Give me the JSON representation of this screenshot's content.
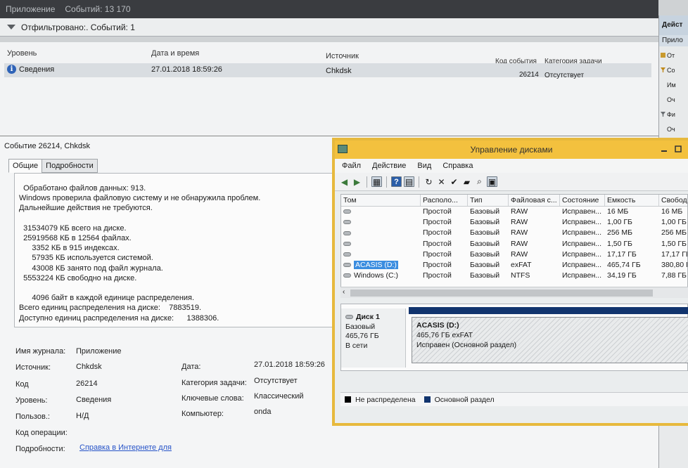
{
  "event_viewer": {
    "header": {
      "title": "Приложение",
      "count": "Событий: 13 170"
    },
    "filter_bar": {
      "text": "Отфильтровано:. Событий: 1"
    },
    "columns": {
      "level": "Уровень",
      "datetime": "Дата и время",
      "source": "Источник",
      "event_id": "Код события",
      "category": "Категория задачи"
    },
    "event": {
      "level": "Сведения",
      "datetime": "27.01.2018 18:59:26",
      "source": "Chkdsk",
      "event_id": "26214",
      "category": "Отсутствует"
    },
    "actions_panel": {
      "title": "Дейст",
      "subtitle": "Прило",
      "items": [
        {
          "label": "От",
          "icon": "folder-icon",
          "color": "#c99a2e"
        },
        {
          "label": "Со",
          "icon": "filter-icon",
          "color": "#c08a1a"
        },
        {
          "label": "Им",
          "icon": "",
          "color": ""
        },
        {
          "label": "Оч",
          "icon": "",
          "color": ""
        },
        {
          "label": "Фи",
          "icon": "filter-icon",
          "color": "#6a6e72"
        },
        {
          "label": "Оч",
          "icon": "",
          "color": ""
        }
      ]
    },
    "detail": {
      "title": "Событие 26214, Chkdsk",
      "tabs": [
        "Общие",
        "Подробности"
      ],
      "description_lines": [
        "  Обработано файлов данных: 913.",
        "Windows проверила файловую систему и не обнаружила проблем.",
        "Дальнейшие действия не требуются.",
        "",
        "  31534079 КБ всего на диске.",
        "  25919568 КБ в 12564 файлах.",
        "      3352 КБ в 915 индексах.",
        "      57935 КБ используется системой.",
        "      43008 КБ занято под файл журнала.",
        "  5553224 КБ свободно на диске.",
        "",
        "      4096 байт в каждой единице распределения.",
        "Всего единиц распределения на диске:    7883519.",
        "Доступно единиц распределения на диске:      1388306."
      ],
      "props": {
        "log_name_label": "Имя журнала:",
        "log_name": "Приложение",
        "source_label": "Источник:",
        "source": "Chkdsk",
        "code_label": "Код",
        "code": "26214",
        "level_label": "Уровень:",
        "level": "Сведения",
        "user_label": "Пользов.:",
        "user": "Н/Д",
        "opcode_label": "Код операции:",
        "opcode": "",
        "details_label": "Подробности:",
        "details_link": "Справка в Интернете для",
        "date_label": "Дата:",
        "date": "27.01.2018 18:59:26",
        "category_label": "Категория задачи:",
        "category": "Отсутствует",
        "keywords_label": "Ключевые слова:",
        "keywords": "Классический",
        "computer_label": "Компьютер:",
        "computer": "onda"
      }
    }
  },
  "disk_management": {
    "title": "Управление дисками",
    "menu": [
      "Файл",
      "Действие",
      "Вид",
      "Справка"
    ],
    "toolbar": [
      {
        "icon": "back-arrow-icon",
        "glyph": "◀"
      },
      {
        "icon": "forward-arrow-icon",
        "glyph": "▶"
      },
      {
        "icon": "show-pane-icon",
        "glyph": "▦"
      },
      {
        "icon": "help-icon",
        "glyph": "?"
      },
      {
        "icon": "properties-icon",
        "glyph": "▤"
      },
      {
        "icon": "refresh-icon",
        "glyph": "↻"
      },
      {
        "icon": "delete-icon",
        "glyph": "✕"
      },
      {
        "icon": "checkmark-icon",
        "glyph": "✔"
      },
      {
        "icon": "open-folder-icon",
        "glyph": "▰"
      },
      {
        "icon": "search-icon",
        "glyph": "⌕"
      },
      {
        "icon": "console-icon",
        "glyph": "▣"
      }
    ],
    "volume_columns": [
      "Том",
      "Располо...",
      "Тип",
      "Файловая с...",
      "Состояние",
      "Емкость",
      "Свобод..."
    ],
    "volumes": [
      [
        "",
        "Простой",
        "Базовый",
        "RAW",
        "Исправен...",
        "16 МБ",
        "16 МБ"
      ],
      [
        "",
        "Простой",
        "Базовый",
        "RAW",
        "Исправен...",
        "1,00 ГБ",
        "1,00 ГБ"
      ],
      [
        "",
        "Простой",
        "Базовый",
        "RAW",
        "Исправен...",
        "256 МБ",
        "256 МБ"
      ],
      [
        "",
        "Простой",
        "Базовый",
        "RAW",
        "Исправен...",
        "1,50 ГБ",
        "1,50 ГБ"
      ],
      [
        "",
        "Простой",
        "Базовый",
        "RAW",
        "Исправен...",
        "17,17 ГБ",
        "17,17 ГБ"
      ],
      [
        "ACASIS (D:)",
        "Простой",
        "Базовый",
        "exFAT",
        "Исправен...",
        "465,74 ГБ",
        "380,80 ГБ"
      ],
      [
        "Windows (C:)",
        "Простой",
        "Базовый",
        "NTFS",
        "Исправен...",
        "34,19 ГБ",
        "7,88 ГБ"
      ]
    ],
    "selected_volume_index": 5,
    "disk": {
      "name": "Диск 1",
      "type": "Базовый",
      "size": "465,76 ГБ",
      "status": "В сети",
      "partition": {
        "name": "ACASIS  (D:)",
        "size_fs": "465,76 ГБ exFAT",
        "status": "Исправен (Основной раздел)"
      }
    },
    "legend": [
      {
        "label": "Не распределена",
        "color": "#000000"
      },
      {
        "label": "Основной раздел",
        "color": "#11346e"
      }
    ]
  }
}
